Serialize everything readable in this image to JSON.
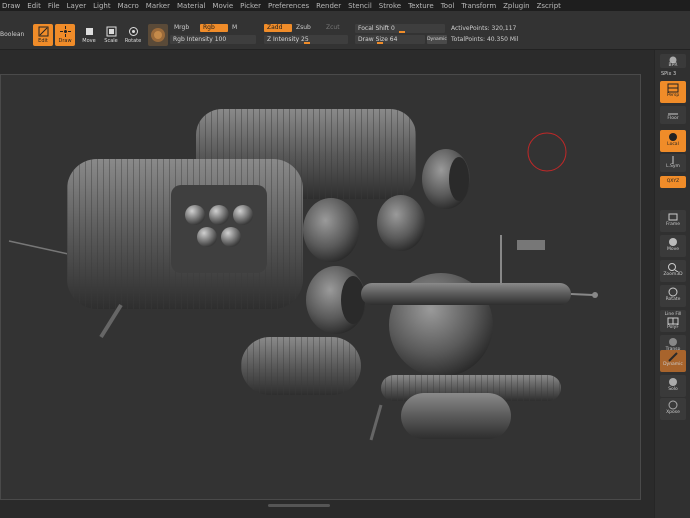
{
  "menu": [
    "Draw",
    "Edit",
    "File",
    "Layer",
    "Light",
    "Macro",
    "Marker",
    "Material",
    "Movie",
    "Picker",
    "Preferences",
    "Render",
    "Stencil",
    "Stroke",
    "Texture",
    "Tool",
    "Transform",
    "Zplugin",
    "Zscript"
  ],
  "toolbar": {
    "boolean_label": "Boolean",
    "edit_label": "Edit",
    "draw_label": "Draw",
    "move_label": "Move",
    "scale_label": "Scale",
    "rotate_label": "Rotate",
    "mrgb_label": "Mrgb",
    "rgb_label": "Rgb",
    "m_label": "M",
    "rgb_intensity_label": "Rgb Intensity 100",
    "zadd_label": "Zadd",
    "zsub_label": "Zsub",
    "zcut_label": "Zcut",
    "z_intensity_label": "Z Intensity 25",
    "focal_shift_label": "Focal Shift 0",
    "draw_size_label": "Draw Size 64",
    "dynamic_label": "Dynamic",
    "active_points": "ActivePoints: 320,117",
    "total_points": "TotalPoints: 40.350 Mil"
  },
  "shelf": {
    "bpr": "BPR",
    "spix": "SPix 3",
    "persp": "Persp",
    "floor": "Floor",
    "local": "Local",
    "lsym": "L.Sym",
    "qxyz": "QXYZ",
    "frame": "Frame",
    "move": "Move",
    "zoom3d": "Zoom3D",
    "rotate": "Rotate",
    "linefill": "Line Fill",
    "polyf": "PolyF",
    "transp": "Transp",
    "dynamic": "Dynamic",
    "solo": "Solo",
    "xpose": "Xpose"
  },
  "colors": {
    "accent": "#f08c29",
    "background": "#2b2b2b",
    "brush_cursor": "#c02828"
  }
}
